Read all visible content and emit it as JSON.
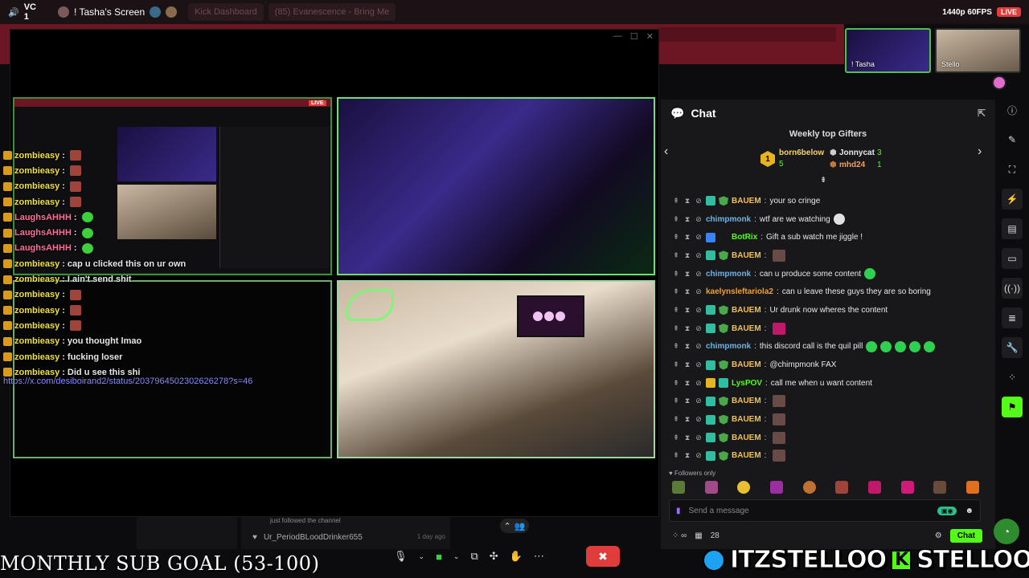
{
  "top_bar": {
    "channel": "VC 1",
    "screen_share_label": "! Tasha's Screen",
    "tabs": [
      "Kick Dashboard",
      "(85) Evanescence - Bring Me"
    ],
    "quality": "1440p 60FPS",
    "live": "LIVE"
  },
  "overlay_chat": {
    "lines": [
      {
        "user": "zombieasy",
        "text": "",
        "emote": "brown",
        "color": "z"
      },
      {
        "user": "zombieasy",
        "text": "",
        "emote": "brown",
        "color": "z"
      },
      {
        "user": "zombieasy",
        "text": "",
        "emote": "brown",
        "color": "z"
      },
      {
        "user": "zombieasy",
        "text": "",
        "emote": "brown",
        "color": "z"
      },
      {
        "user": "LaughsAHHH",
        "text": "",
        "emote": "green",
        "color": "l"
      },
      {
        "user": "LaughsAHHH",
        "text": "",
        "emote": "green",
        "color": "l"
      },
      {
        "user": "LaughsAHHH",
        "text": "",
        "emote": "green",
        "color": "l"
      },
      {
        "user": "zombieasy",
        "text": "cap u clicked this on ur own",
        "emote": "",
        "color": "z"
      },
      {
        "user": "zombieasy",
        "text": "I ain't send shit",
        "emote": "",
        "color": "z"
      },
      {
        "user": "zombieasy",
        "text": "",
        "emote": "brown",
        "color": "z"
      },
      {
        "user": "zombieasy",
        "text": "",
        "emote": "brown",
        "color": "z"
      },
      {
        "user": "zombieasy",
        "text": "",
        "emote": "brown",
        "color": "z"
      },
      {
        "user": "zombieasy",
        "text": "you thought lmao",
        "emote": "",
        "color": "z"
      },
      {
        "user": "zombieasy",
        "text": "fucking loser",
        "emote": "",
        "color": "z"
      },
      {
        "user": "zombieasy",
        "text": "Did u see this shi",
        "emote": "",
        "color": "z"
      }
    ],
    "link": "https://x.com/desiboirand2/status/2037964502302626278?s=46"
  },
  "follow_feed": {
    "caption": "just followed the channel",
    "user": "Ur_PeriodBLoodDrinker655",
    "ago": "1 day ago"
  },
  "banner": {
    "goal": "MONTHLY SUB GOAL (53-100)",
    "twitter": "ITZSTELLOO",
    "kick": "STELLOOO"
  },
  "cams": [
    {
      "label": "! Tasha"
    },
    {
      "label": "Stello"
    }
  ],
  "chat": {
    "title": "Chat",
    "gifters_title": "Weekly top Gifters",
    "gifters": [
      {
        "rank": "1",
        "name": "born6below",
        "count": "5"
      },
      {
        "name": "Jonnycat",
        "count": "3"
      },
      {
        "name": "mhd24",
        "count": "1"
      }
    ],
    "messages": [
      {
        "user": "BAUEM",
        "text": "your so cringe",
        "cls": "bauem",
        "badges": [
          "og",
          "sh"
        ],
        "emotes": []
      },
      {
        "user": "chimpmonk",
        "text": "wtf are we watching",
        "cls": "chimp",
        "badges": [],
        "emotes": [
          "wh"
        ]
      },
      {
        "user": "BotRix",
        "text": "Gift a sub watch me jiggle !",
        "cls": "botrix",
        "badges": [
          "bot",
          "gr"
        ],
        "emotes": []
      },
      {
        "user": "BAUEM",
        "text": "",
        "cls": "bauem",
        "badges": [
          "og",
          "sh"
        ],
        "emotes": [
          "br"
        ]
      },
      {
        "user": "chimpmonk",
        "text": "can u produce some content",
        "cls": "chimp",
        "badges": [],
        "emotes": [
          "gr"
        ]
      },
      {
        "user": "kaelynsleftariola2",
        "text": "can u leave these guys they are so boring",
        "cls": "kaely",
        "badges": [],
        "emotes": []
      },
      {
        "user": "BAUEM",
        "text": "Ur drunk now wheres the content",
        "cls": "bauem",
        "badges": [
          "og",
          "sh"
        ],
        "emotes": []
      },
      {
        "user": "BAUEM",
        "text": "",
        "cls": "bauem",
        "badges": [
          "og",
          "sh"
        ],
        "emotes": [
          "pk"
        ]
      },
      {
        "user": "chimpmonk",
        "text": "this discord call is the quil pill",
        "cls": "chimp",
        "badges": [],
        "emotes": [
          "gr",
          "gr",
          "gr",
          "gr",
          "gr"
        ]
      },
      {
        "user": "BAUEM",
        "text": "@chimpmonk FAX",
        "cls": "bauem",
        "badges": [
          "og",
          "sh"
        ],
        "emotes": []
      },
      {
        "user": "LysPOV",
        "text": "call me when u want content",
        "cls": "lys",
        "badges": [
          "gold",
          "og"
        ],
        "emotes": []
      },
      {
        "user": "BAUEM",
        "text": "",
        "cls": "bauem",
        "badges": [
          "og",
          "sh"
        ],
        "emotes": [
          "br"
        ]
      },
      {
        "user": "BAUEM",
        "text": "",
        "cls": "bauem",
        "badges": [
          "og",
          "sh"
        ],
        "emotes": [
          "br"
        ]
      },
      {
        "user": "BAUEM",
        "text": "",
        "cls": "bauem",
        "badges": [
          "og",
          "sh"
        ],
        "emotes": [
          "br"
        ]
      },
      {
        "user": "BAUEM",
        "text": "",
        "cls": "bauem",
        "badges": [
          "og",
          "sh"
        ],
        "emotes": [
          "br"
        ]
      }
    ],
    "followers_only": "Followers only",
    "input_placeholder": "Send a message",
    "viewer_count": "28",
    "chat_button": "Chat"
  }
}
